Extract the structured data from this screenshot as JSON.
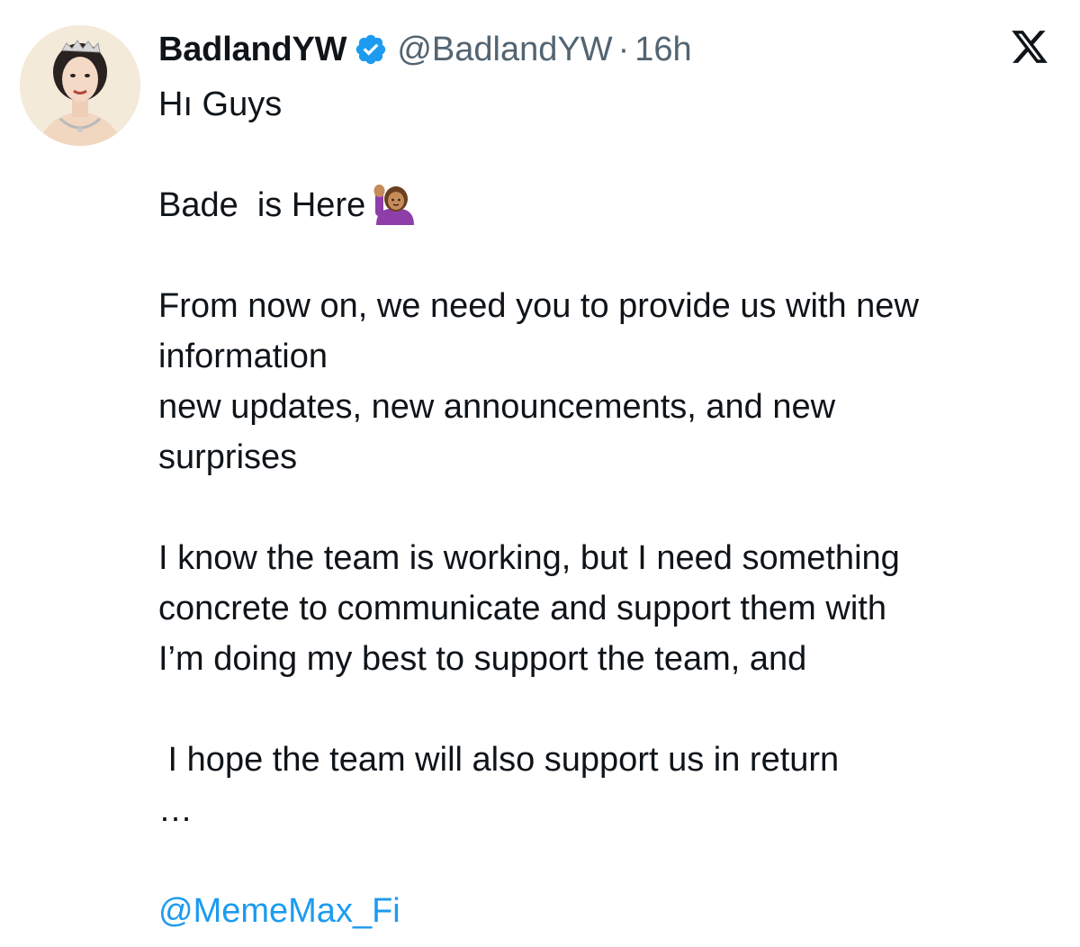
{
  "author": {
    "display_name": "BadlandYW",
    "handle": "@BadlandYW",
    "separator": "·",
    "time": "16h",
    "verified_icon": "verified-badge-icon",
    "avatar_icon": "avatar-portrait"
  },
  "platform_logo": "x-logo-icon",
  "tweet": {
    "line_1": "Hı Guys",
    "line_2": "Bade  is Here",
    "line_2_emoji": "person-raising-hand-emoji",
    "line_3": "From now on, we need you to provide us with new",
    "line_4": "information",
    "line_5": "new updates, new announcements, and new",
    "line_6": "surprises",
    "line_7": "I know the team is working, but I need something",
    "line_8": "concrete to communicate and support them with",
    "line_9": "I’m doing my best to support the team, and",
    "line_10": " I hope the team will also support us in return",
    "line_11": "…",
    "mention": "@MemeMax_Fi"
  },
  "colors": {
    "text": "#0f1419",
    "secondary": "#536471",
    "link": "#1d9bf0",
    "verified": "#1d9bf0"
  }
}
